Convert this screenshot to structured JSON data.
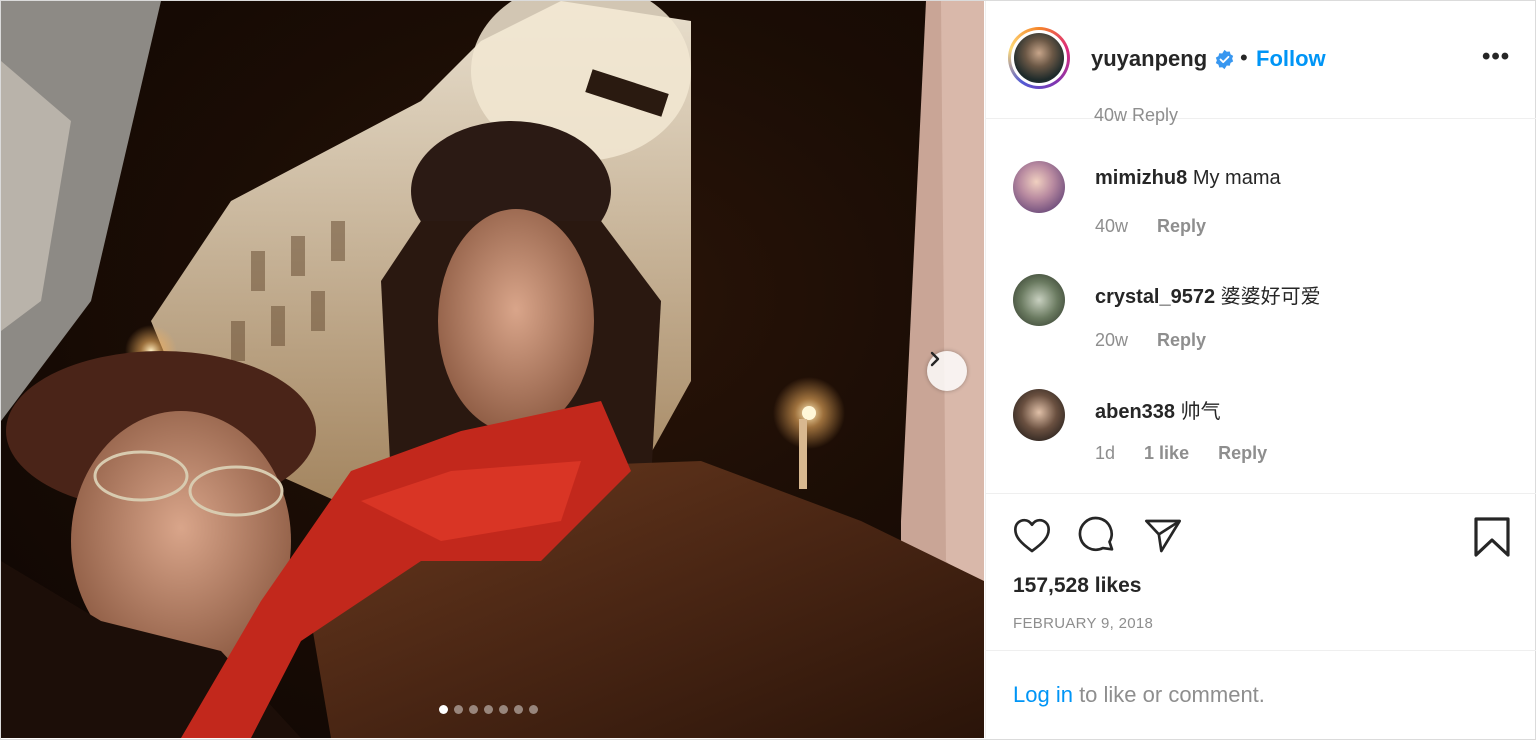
{
  "post": {
    "username": "yuyanpeng",
    "separator": "•",
    "follow_label": "Follow",
    "more_label": "•••",
    "cutoff_text": "40w   Reply",
    "carousel_count": 7,
    "carousel_active": 0
  },
  "comments": [
    {
      "user": "mimizhu8",
      "text": "My mama",
      "time": "40w",
      "likes": "",
      "reply": "Reply"
    },
    {
      "user": "crystal_9572",
      "text": "婆婆好可爱",
      "time": "20w",
      "likes": "",
      "reply": "Reply"
    },
    {
      "user": "aben338",
      "text": "帅气",
      "time": "1d",
      "likes": "1 like",
      "reply": "Reply"
    }
  ],
  "actions": {
    "likes": "157,528 likes",
    "date": "FEBRUARY 9, 2018"
  },
  "footer": {
    "login_link": "Log in",
    "login_rest": " to like or comment."
  },
  "colors": {
    "accent": "#0095f6",
    "text": "#262626",
    "muted": "#8e8e8e",
    "scarf_red": "#c2281c"
  }
}
